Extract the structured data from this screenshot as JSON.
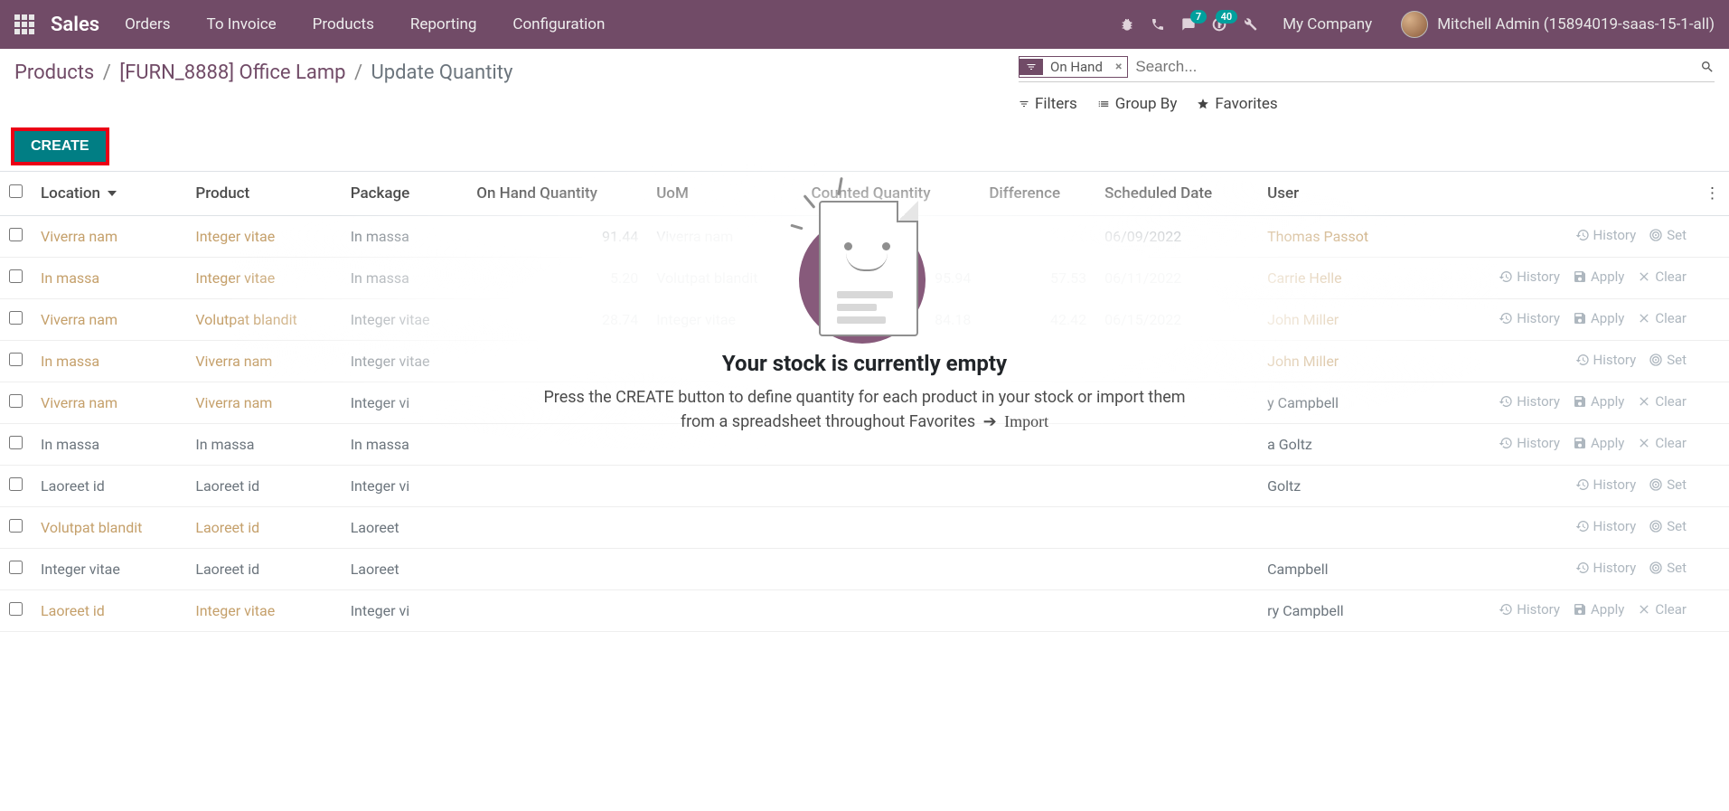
{
  "navbar": {
    "brand": "Sales",
    "menu": [
      "Orders",
      "To Invoice",
      "Products",
      "Reporting",
      "Configuration"
    ],
    "msg_badge": "7",
    "activity_badge": "40",
    "company": "My Company",
    "user": "Mitchell Admin (15894019-saas-15-1-all)"
  },
  "breadcrumb": {
    "p0": "Products",
    "p1": "[FURN_8888] Office Lamp",
    "p2": "Update Quantity"
  },
  "search": {
    "facet_label": "On Hand",
    "placeholder": "Search..."
  },
  "filterbar": {
    "filters": "Filters",
    "groupby": "Group By",
    "favorites": "Favorites"
  },
  "buttons": {
    "create": "CREATE"
  },
  "columns": {
    "location": "Location",
    "product": "Product",
    "package": "Package",
    "onhand": "On Hand Quantity",
    "uom": "UoM",
    "counted": "Counted Quantity",
    "difference": "Difference",
    "scheduled": "Scheduled Date",
    "user": "User"
  },
  "actions": {
    "history": "History",
    "set": "Set",
    "apply": "Apply",
    "clear": "Clear"
  },
  "rows": [
    {
      "location": "Viverra nam",
      "product": "Integer vitae",
      "package": "In massa",
      "onhand": "91.44",
      "uom": "Viverra nam",
      "counted": "",
      "difference": "",
      "scheduled": "06/09/2022",
      "user": "Thomas Passot",
      "btn": "set",
      "loc_link": true,
      "prod_link": true,
      "user_link": true
    },
    {
      "location": "In massa",
      "product": "Integer vitae",
      "package": "In massa",
      "onhand": "5.20",
      "uom": "Volutpat blandit",
      "counted": "95.94",
      "difference": "57.53",
      "scheduled": "06/11/2022",
      "user": "Carrie Helle",
      "btn": "apply",
      "loc_link": true,
      "prod_link": true,
      "user_link": true
    },
    {
      "location": "Viverra nam",
      "product": "Volutpat blandit",
      "package": "Integer vitae",
      "onhand": "28.74",
      "uom": "Integer vitae",
      "counted": "84.18",
      "difference": "42.42",
      "scheduled": "06/15/2022",
      "user": "John Miller",
      "btn": "apply",
      "loc_link": true,
      "prod_link": true,
      "user_link": true
    },
    {
      "location": "In massa",
      "product": "Viverra nam",
      "package": "Integer vitae",
      "onhand": "",
      "uom": "",
      "counted": "",
      "difference": "",
      "scheduled": "",
      "user": "John Miller",
      "btn": "set",
      "loc_link": true,
      "prod_link": true,
      "user_link": true
    },
    {
      "location": "Viverra nam",
      "product": "Viverra nam",
      "package": "Integer vi",
      "onhand": "",
      "uom": "",
      "counted": "",
      "difference": "",
      "scheduled": "",
      "user": "y Campbell",
      "btn": "apply",
      "loc_link": true,
      "prod_link": true,
      "user_link": false
    },
    {
      "location": "In massa",
      "product": "In massa",
      "package": "In massa",
      "onhand": "",
      "uom": "",
      "counted": "",
      "difference": "",
      "scheduled": "",
      "user": "a Goltz",
      "btn": "apply",
      "loc_link": false,
      "prod_link": false,
      "user_link": false
    },
    {
      "location": "Laoreet id",
      "product": "Laoreet id",
      "package": "Integer vi",
      "onhand": "",
      "uom": "",
      "counted": "",
      "difference": "",
      "scheduled": "",
      "user": "Goltz",
      "btn": "set",
      "loc_link": false,
      "prod_link": false,
      "user_link": false
    },
    {
      "location": "Volutpat blandit",
      "product": "Laoreet id",
      "package": "Laoreet",
      "onhand": "",
      "uom": "",
      "counted": "",
      "difference": "",
      "scheduled": "",
      "user": "",
      "btn": "set",
      "loc_link": true,
      "prod_link": true,
      "user_link": false
    },
    {
      "location": "Integer vitae",
      "product": "Laoreet id",
      "package": "Laoreet",
      "onhand": "",
      "uom": "",
      "counted": "",
      "difference": "",
      "scheduled": "",
      "user": "Campbell",
      "btn": "set",
      "loc_link": false,
      "prod_link": false,
      "user_link": false
    },
    {
      "location": "Laoreet id",
      "product": "Integer vitae",
      "package": "Integer vi",
      "onhand": "",
      "uom": "",
      "counted": "",
      "difference": "",
      "scheduled": "",
      "user": "ry Campbell",
      "btn": "apply",
      "loc_link": true,
      "prod_link": true,
      "user_link": false
    }
  ],
  "empty": {
    "title": "Your stock is currently empty",
    "sub1": "Press the CREATE button to define quantity for each product in your stock or import them",
    "sub2": "from a spreadsheet throughout Favorites",
    "import": "Import"
  }
}
